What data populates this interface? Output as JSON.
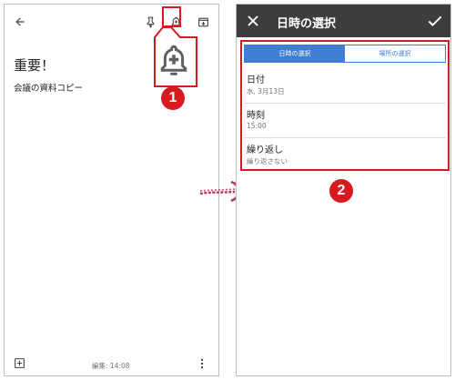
{
  "left_screen": {
    "note_title": "重要！",
    "note_body": "会議の資料コピー",
    "edited_label": "編集: 14:08",
    "icons": {
      "back": "arrow-left-icon",
      "pin": "pin-icon",
      "reminder": "bell-plus-icon",
      "archive": "archive-icon",
      "add": "add-box-icon",
      "more": "more-vert-icon"
    },
    "callout_number": "1"
  },
  "right_screen": {
    "title": "日時の選択",
    "icons": {
      "close": "close-icon",
      "confirm": "check-icon"
    },
    "tabs": [
      {
        "label": "日時の選択",
        "selected": true
      },
      {
        "label": "場所の選択",
        "selected": false
      }
    ],
    "rows": [
      {
        "label": "日付",
        "value": "水, 3月13日"
      },
      {
        "label": "時刻",
        "value": "15:00"
      },
      {
        "label": "繰り返し",
        "value": "繰り返さない"
      }
    ],
    "callout_number": "2"
  },
  "colors": {
    "highlight": "#d71920",
    "toolbar_dark": "#3d3d3d",
    "tab_blue": "#3f7fcf",
    "arrow": "#b03a5c"
  }
}
